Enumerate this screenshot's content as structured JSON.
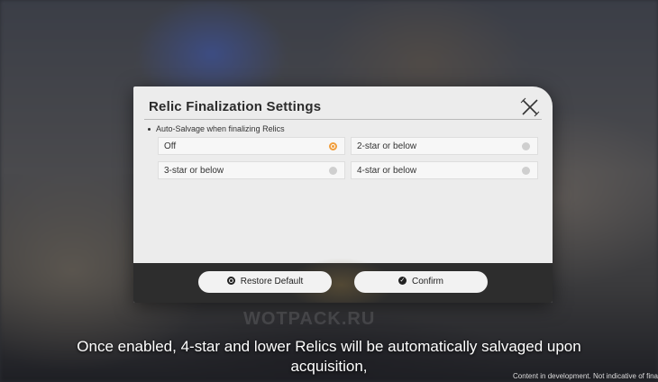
{
  "dialog": {
    "title": "Relic Finalization Settings",
    "section_label": "Auto-Salvage when finalizing Relics",
    "options": [
      {
        "label": "Off",
        "selected": true
      },
      {
        "label": "2-star or below",
        "selected": false
      },
      {
        "label": "3-star or below",
        "selected": false
      },
      {
        "label": "4-star or below",
        "selected": false
      }
    ],
    "buttons": {
      "restore_label": "Restore Default",
      "confirm_label": "Confirm"
    },
    "accent_color": "#f09e3c"
  },
  "subtitle": {
    "line1": "Once enabled, 4-star and lower Relics will be automatically salvaged upon",
    "line2": "acquisition,"
  },
  "watermark": "WOTPACK.RU",
  "notice": "Content in development. Not indicative of fina"
}
